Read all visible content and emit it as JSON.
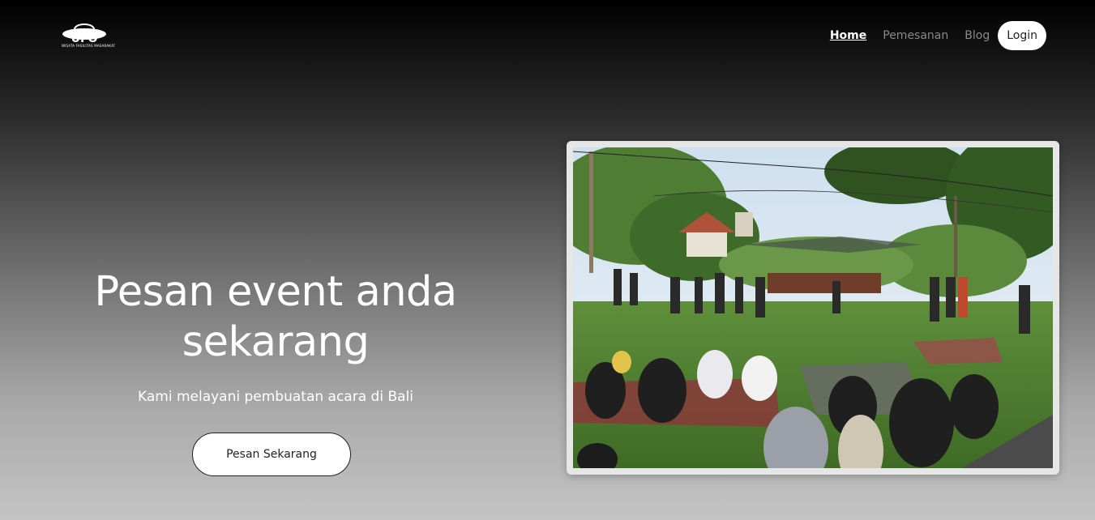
{
  "brand": {
    "logo_text": "UFO",
    "logo_subtext": "WISATA FASILITAS MASARAKAT"
  },
  "nav": {
    "items": [
      {
        "label": "Home",
        "active": true
      },
      {
        "label": "Pemesanan",
        "active": false
      },
      {
        "label": "Blog",
        "active": false
      }
    ],
    "login_label": "Login"
  },
  "hero": {
    "title_line1": "Pesan event anda",
    "title_line2": "sekarang",
    "subtitle": "Kami melayani pembuatan acara di Bali",
    "cta_label": "Pesan Sekarang"
  },
  "colors": {
    "bg_top": "#000000",
    "bg_bottom": "#c4c4c4",
    "text_light": "#ffffff",
    "nav_inactive": "#8a8a8a"
  }
}
